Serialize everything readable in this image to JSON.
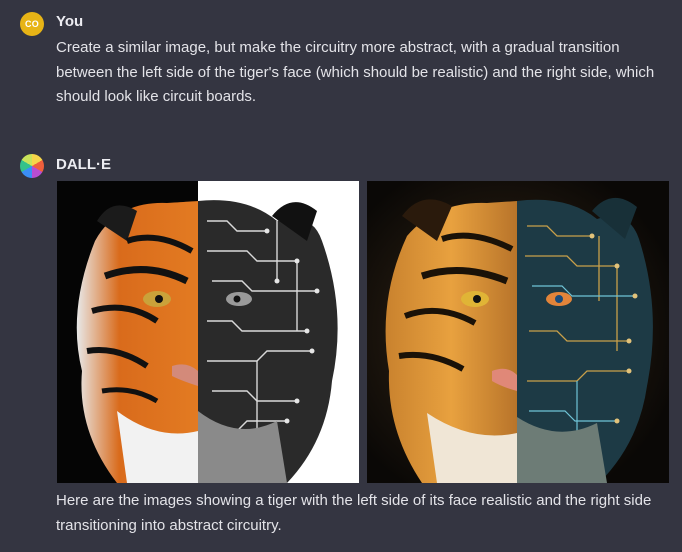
{
  "user_message": {
    "avatar_initials": "CO",
    "author": "You",
    "text": "Create a similar image, but make the circuitry more abstract, with a gradual transition between the left side of the tiger's face (which should be realistic) and the right side, which should look like circuit boards."
  },
  "assistant_message": {
    "author": "DALL·E",
    "images": [
      {
        "name": "tiger-image-1",
        "icon": "tiger-half-circuit-bw"
      },
      {
        "name": "tiger-image-2",
        "icon": "tiger-half-circuit-color"
      }
    ],
    "text": "Here are the images showing a tiger with the left side of its face realistic and the right side transitioning into abstract circuitry."
  },
  "colors": {
    "background": "#343541",
    "text": "#ececf1",
    "user_avatar": "#e7b416"
  }
}
